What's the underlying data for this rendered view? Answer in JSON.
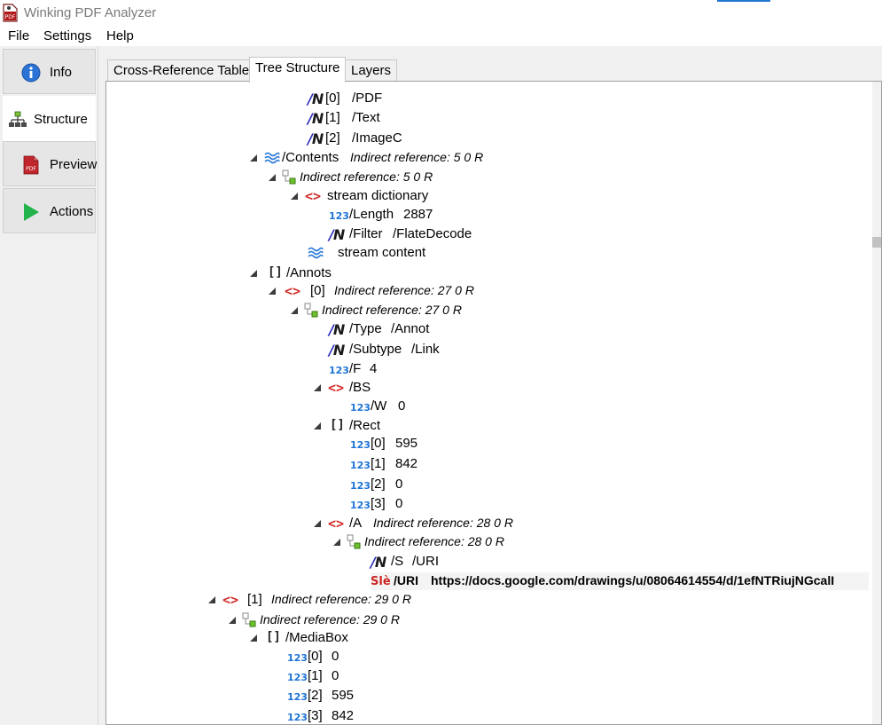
{
  "app": {
    "title": "Winking PDF Analyzer"
  },
  "menu": {
    "file": "File",
    "settings": "Settings",
    "help": "Help"
  },
  "sidebar": {
    "info": "Info",
    "structure": "Structure",
    "preview": "Preview",
    "actions": "Actions"
  },
  "tabs": {
    "xref": "Cross-Reference Table",
    "tree": "Tree Structure",
    "layers": "Layers"
  },
  "tree": {
    "n_pdf_idx": "[0]",
    "n_pdf_val": "/PDF",
    "n_text_idx": "[1]",
    "n_text_val": "/Text",
    "n_imagec_idx": "[2]",
    "n_imagec_val": "/ImageC",
    "contents_name": "/Contents",
    "contents_ref": "Indirect reference: 5 0 R",
    "contents_ind": "Indirect reference: 5 0 R",
    "stream_dict": "stream dictionary",
    "length_name": "/Length",
    "length_val": "2887",
    "filter_name": "/Filter",
    "filter_val": "/FlateDecode",
    "stream_content": "stream content",
    "annots_name": "/Annots",
    "annot0_idx": "[0]",
    "annot0_ref": "Indirect reference: 27 0 R",
    "annot0_ind": "Indirect reference: 27 0 R",
    "type_name": "/Type",
    "type_val": "/Annot",
    "subtype_name": "/Subtype",
    "subtype_val": "/Link",
    "f_name": "/F",
    "f_val": "4",
    "bs_name": "/BS",
    "w_name": "/W",
    "w_val": "0",
    "rect_name": "/Rect",
    "rect0_idx": "[0]",
    "rect0_val": "595",
    "rect1_idx": "[1]",
    "rect1_val": "842",
    "rect2_idx": "[2]",
    "rect2_val": "0",
    "rect3_idx": "[3]",
    "rect3_val": "0",
    "a_name": "/A",
    "a_ref": "Indirect reference: 28 0 R",
    "a_ind": "Indirect reference: 28 0 R",
    "s_name": "/S",
    "s_val": "/URI",
    "uri_name": "/URI",
    "uri_val": "https://docs.google.com/drawings/u/08064614554/d/1efNTRiujNGcalI",
    "page1_idx": "[1]",
    "page1_ref": "Indirect reference: 29 0 R",
    "page1_ind": "Indirect reference: 29 0 R",
    "mediabox_name": "/MediaBox",
    "mb0_idx": "[0]",
    "mb0_val": "0",
    "mb1_idx": "[1]",
    "mb1_val": "0",
    "mb2_idx": "[2]",
    "mb2_val": "595",
    "mb3_idx": "[3]",
    "mb3_val": "842"
  },
  "icons": {
    "name": "name-object-icon",
    "number": "numeric-object-icon",
    "dictionary": "dictionary-icon",
    "array": "array-icon",
    "string": "string-object-icon",
    "stream": "stream-icon",
    "reference": "indirect-reference-icon"
  },
  "colors": {
    "accent": "#1f77d0",
    "dict": "#d12a2a",
    "number": "#1f74d6",
    "name_slash": "#2e2ebf"
  }
}
